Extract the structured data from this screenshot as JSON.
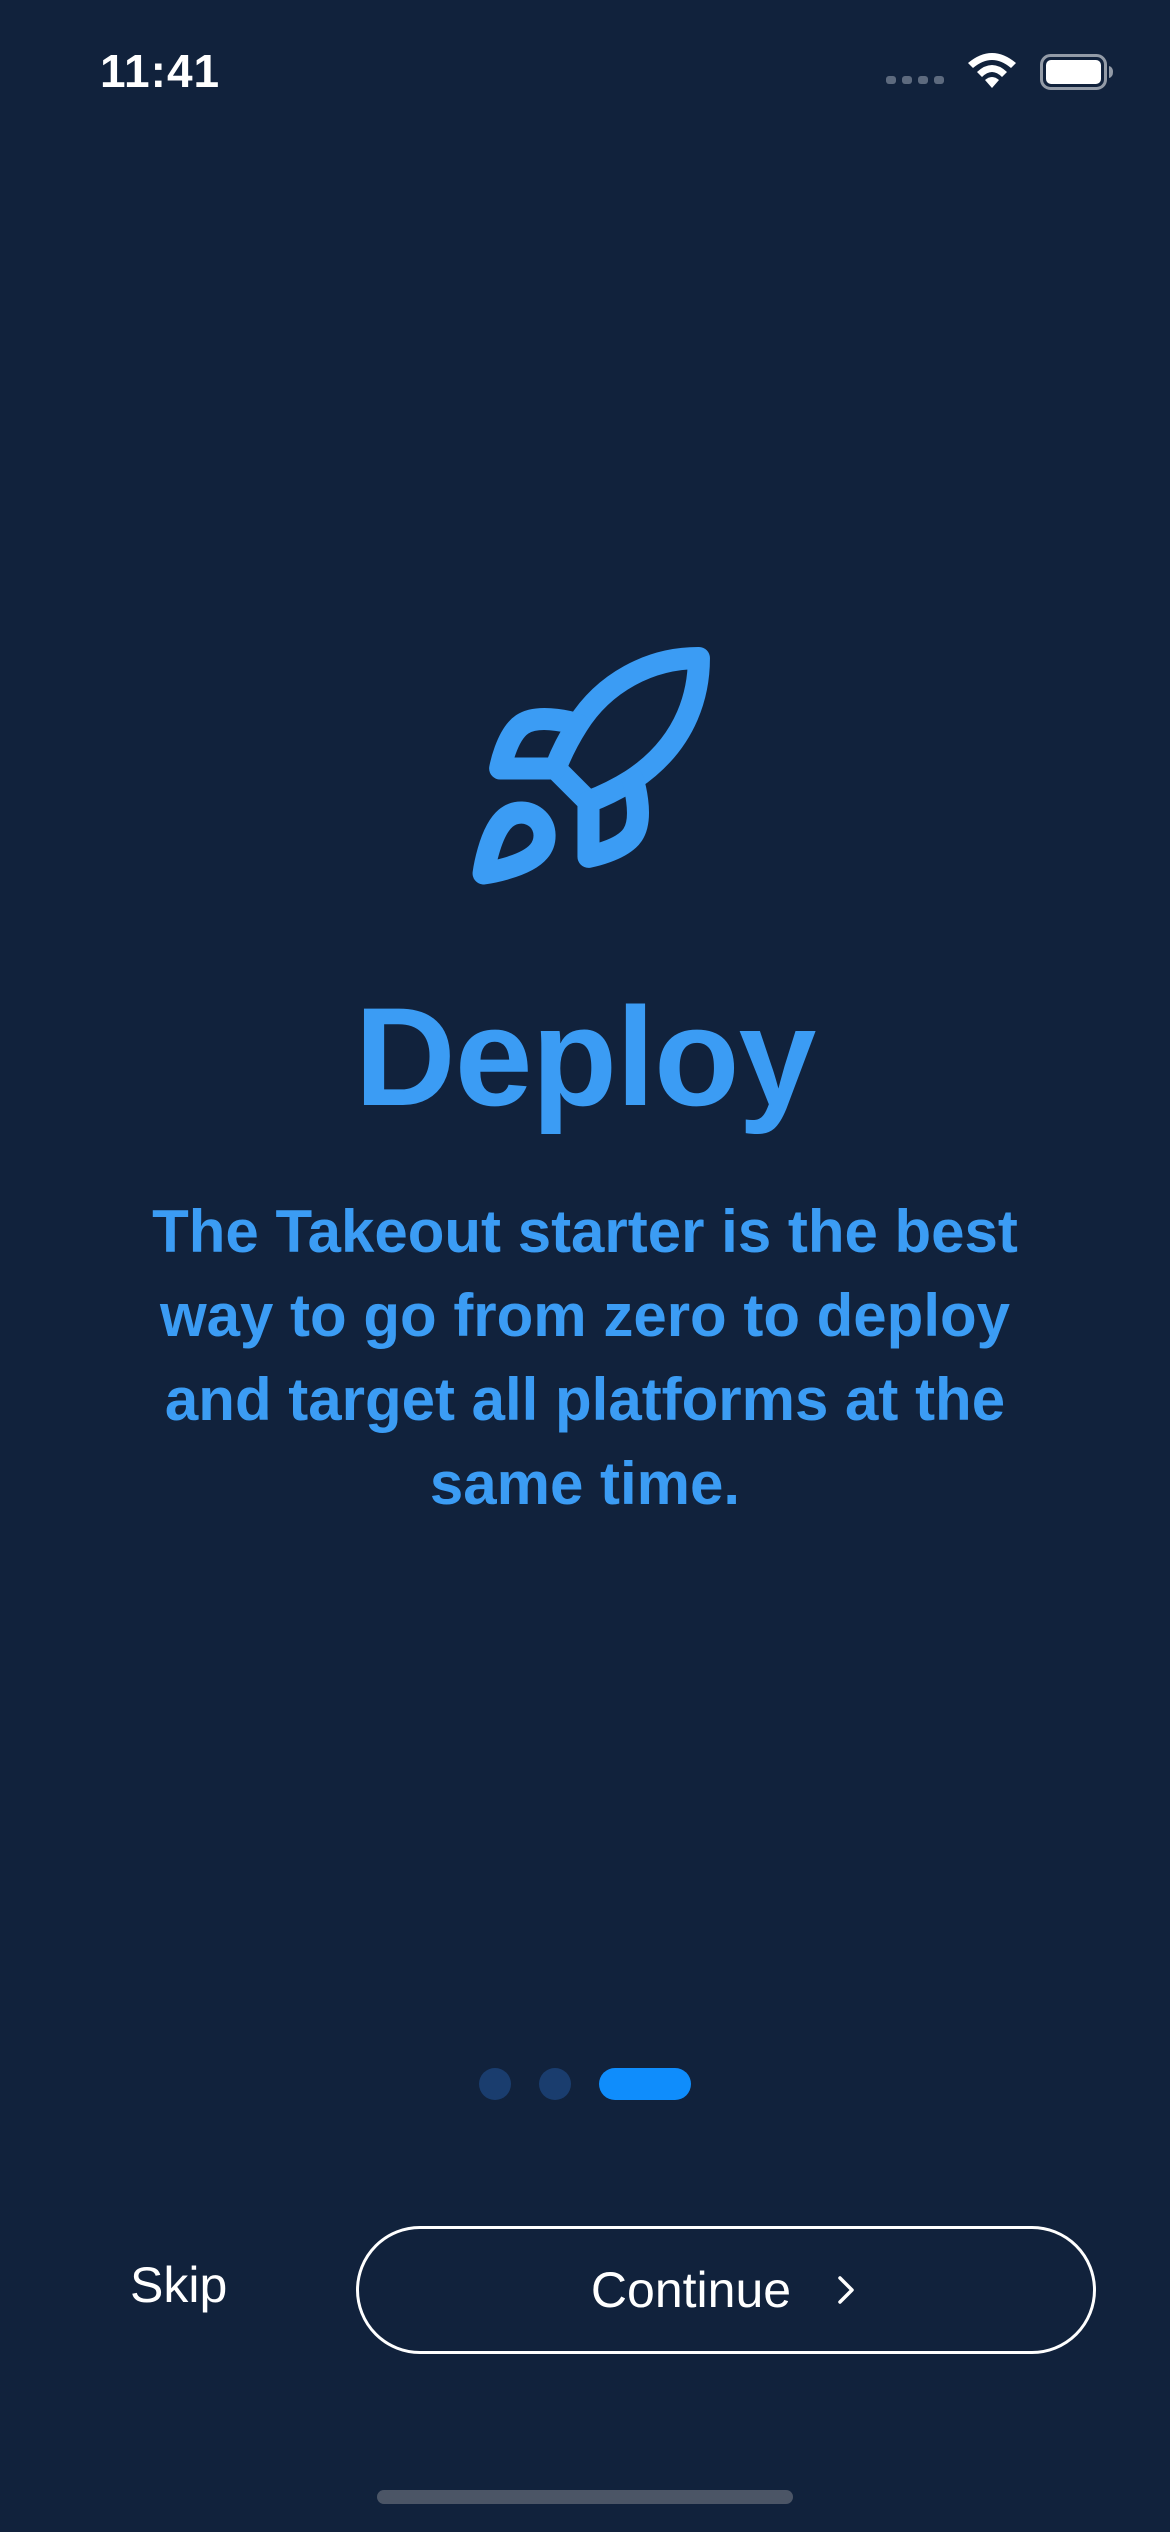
{
  "status_bar": {
    "time": "11:41",
    "icons": [
      "signal-dots-icon",
      "wifi-icon",
      "battery-icon"
    ]
  },
  "onboarding": {
    "icon": "rocket-icon",
    "title": "Deploy",
    "description": "The Takeout starter is the best way to go from zero to deploy and target all platforms at the same time.",
    "accent_color": "#3b9cf4",
    "background_color": "#11223c"
  },
  "pager": {
    "total_pages": 3,
    "current_page": 3,
    "active_color": "#0f8dfc",
    "inactive_color": "#1a3d6e"
  },
  "actions": {
    "skip_label": "Skip",
    "continue_label": "Continue",
    "continue_icon": "chevron-right-icon"
  }
}
